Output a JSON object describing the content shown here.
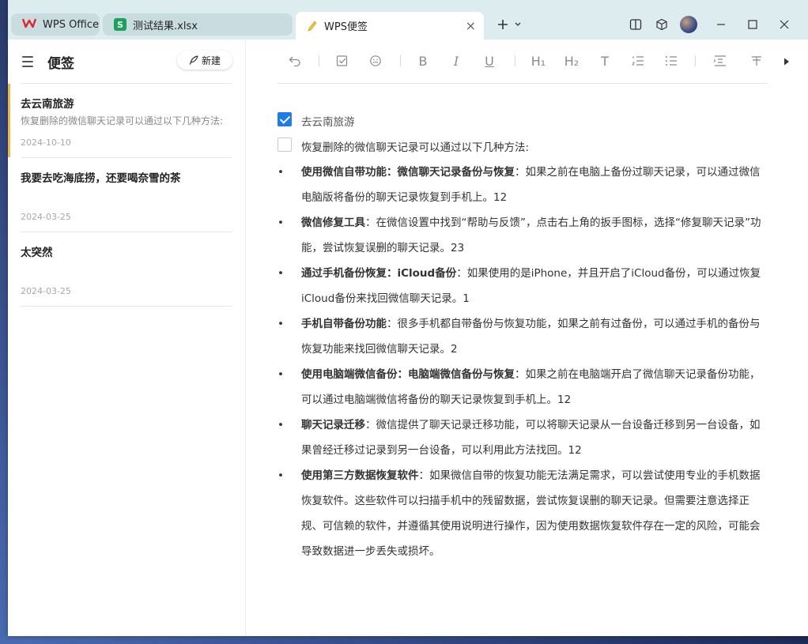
{
  "tabs": [
    {
      "label": "WPS Office"
    },
    {
      "label": "测试结果.xlsx"
    },
    {
      "label": "WPS便签"
    }
  ],
  "sidebar": {
    "title": "便签",
    "new_button": "新建",
    "notes": [
      {
        "title": "去云南旅游",
        "preview": "恢复删除的微信聊天记录可以通过以下几种方法:",
        "date": "2024-10-10"
      },
      {
        "title": "我要去吃海底捞，还要喝奈雪的茶",
        "preview": "",
        "date": "2024-03-25"
      },
      {
        "title": "太突然",
        "preview": "",
        "date": "2024-03-25"
      }
    ]
  },
  "toolbar": {
    "bold": "B",
    "italic": "I",
    "underline": "U",
    "h1": "H₁",
    "h2": "H₂",
    "text": "T"
  },
  "editor": {
    "checklist": [
      {
        "text": "去云南旅游",
        "checked": true
      },
      {
        "text": "恢复删除的微信聊天记录可以通过以下几种方法:",
        "checked": false
      }
    ],
    "bullets": [
      {
        "bold": "使用微信自带功能：微信聊天记录备份与恢复",
        "text": "：如果之前在电脑上备份过聊天记录，可以通过微信电脑版将备份的聊天记录恢复到手机上。12"
      },
      {
        "bold": "微信修复工具",
        "text": "：在微信设置中找到“帮助与反馈”，点击右上角的扳手图标，选择“修复聊天记录”功能，尝试恢复误删的聊天记录。23"
      },
      {
        "bold": "通过手机备份恢复：iCloud备份",
        "text": "：如果使用的是iPhone，并且开启了iCloud备份，可以通过恢复iCloud备份来找回微信聊天记录。1"
      },
      {
        "bold": "手机自带备份功能",
        "text": "：很多手机都自带备份与恢复功能，如果之前有过备份，可以通过手机的备份与恢复功能来找回微信聊天记录。2"
      },
      {
        "bold": "使用电脑端微信备份：电脑端微信备份与恢复",
        "text": "：如果之前在电脑端开启了微信聊天记录备份功能，可以通过电脑端微信将备份的聊天记录恢复到手机上。12"
      },
      {
        "bold": "聊天记录迁移",
        "text": "：微信提供了聊天记录迁移功能，可以将聊天记录从一台设备迁移到另一台设备，如果曾经迁移过记录到另一台设备，可以利用此方法找回。12"
      },
      {
        "bold": "使用第三方数据恢复软件",
        "text": "：如果微信自带的恢复功能无法满足需求，可以尝试使用专业的手机数据恢复软件。这些软件可以扫描手机中的残留数据，尝试恢复误删的聊天记录。但需要注意选择正规、可信赖的软件，并遵循其使用说明进行操作，因为使用数据恢复软件存在一定的风险，可能会导致数据进一步丢失或损坏。"
      }
    ]
  },
  "colors": {
    "accent": "#1f7be8",
    "active_note_bar": "#e9b84a",
    "titlebar": "#dcecef",
    "brand_red": "#e0242c",
    "sheet_green": "#1aa25c"
  }
}
